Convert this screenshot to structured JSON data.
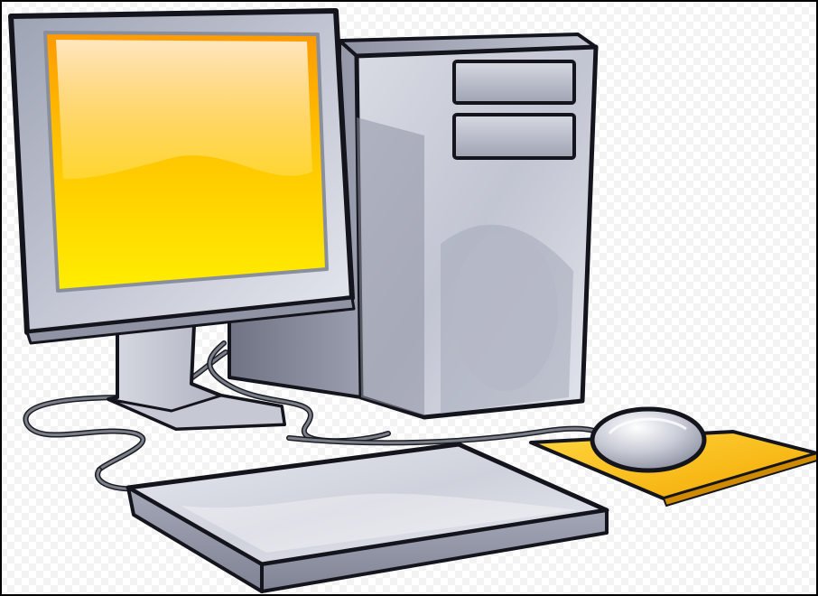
{
  "scene": {
    "background": "checkerboard-transparency",
    "subject": "desktop-computer",
    "parts": [
      "monitor",
      "tower-case",
      "keyboard",
      "mouse",
      "mouse-pad",
      "cables"
    ]
  },
  "colors": {
    "background": "#ffffff",
    "checker": "#f3f3f3",
    "frame": "#000000",
    "outline": "#14141c",
    "screen_glow": "#fff7b0",
    "screen_top": "#ff9a00",
    "screen_mid": "#ffd000",
    "screen_bottom": "#ffee00",
    "screen_border": "#8a8f9e",
    "case_light": "#e4e6ee",
    "case_mid": "#b9bdcc",
    "case_dark": "#7e8292",
    "pad_light": "#ffd640",
    "pad_dark": "#f3a800",
    "cable": "#55585f"
  }
}
